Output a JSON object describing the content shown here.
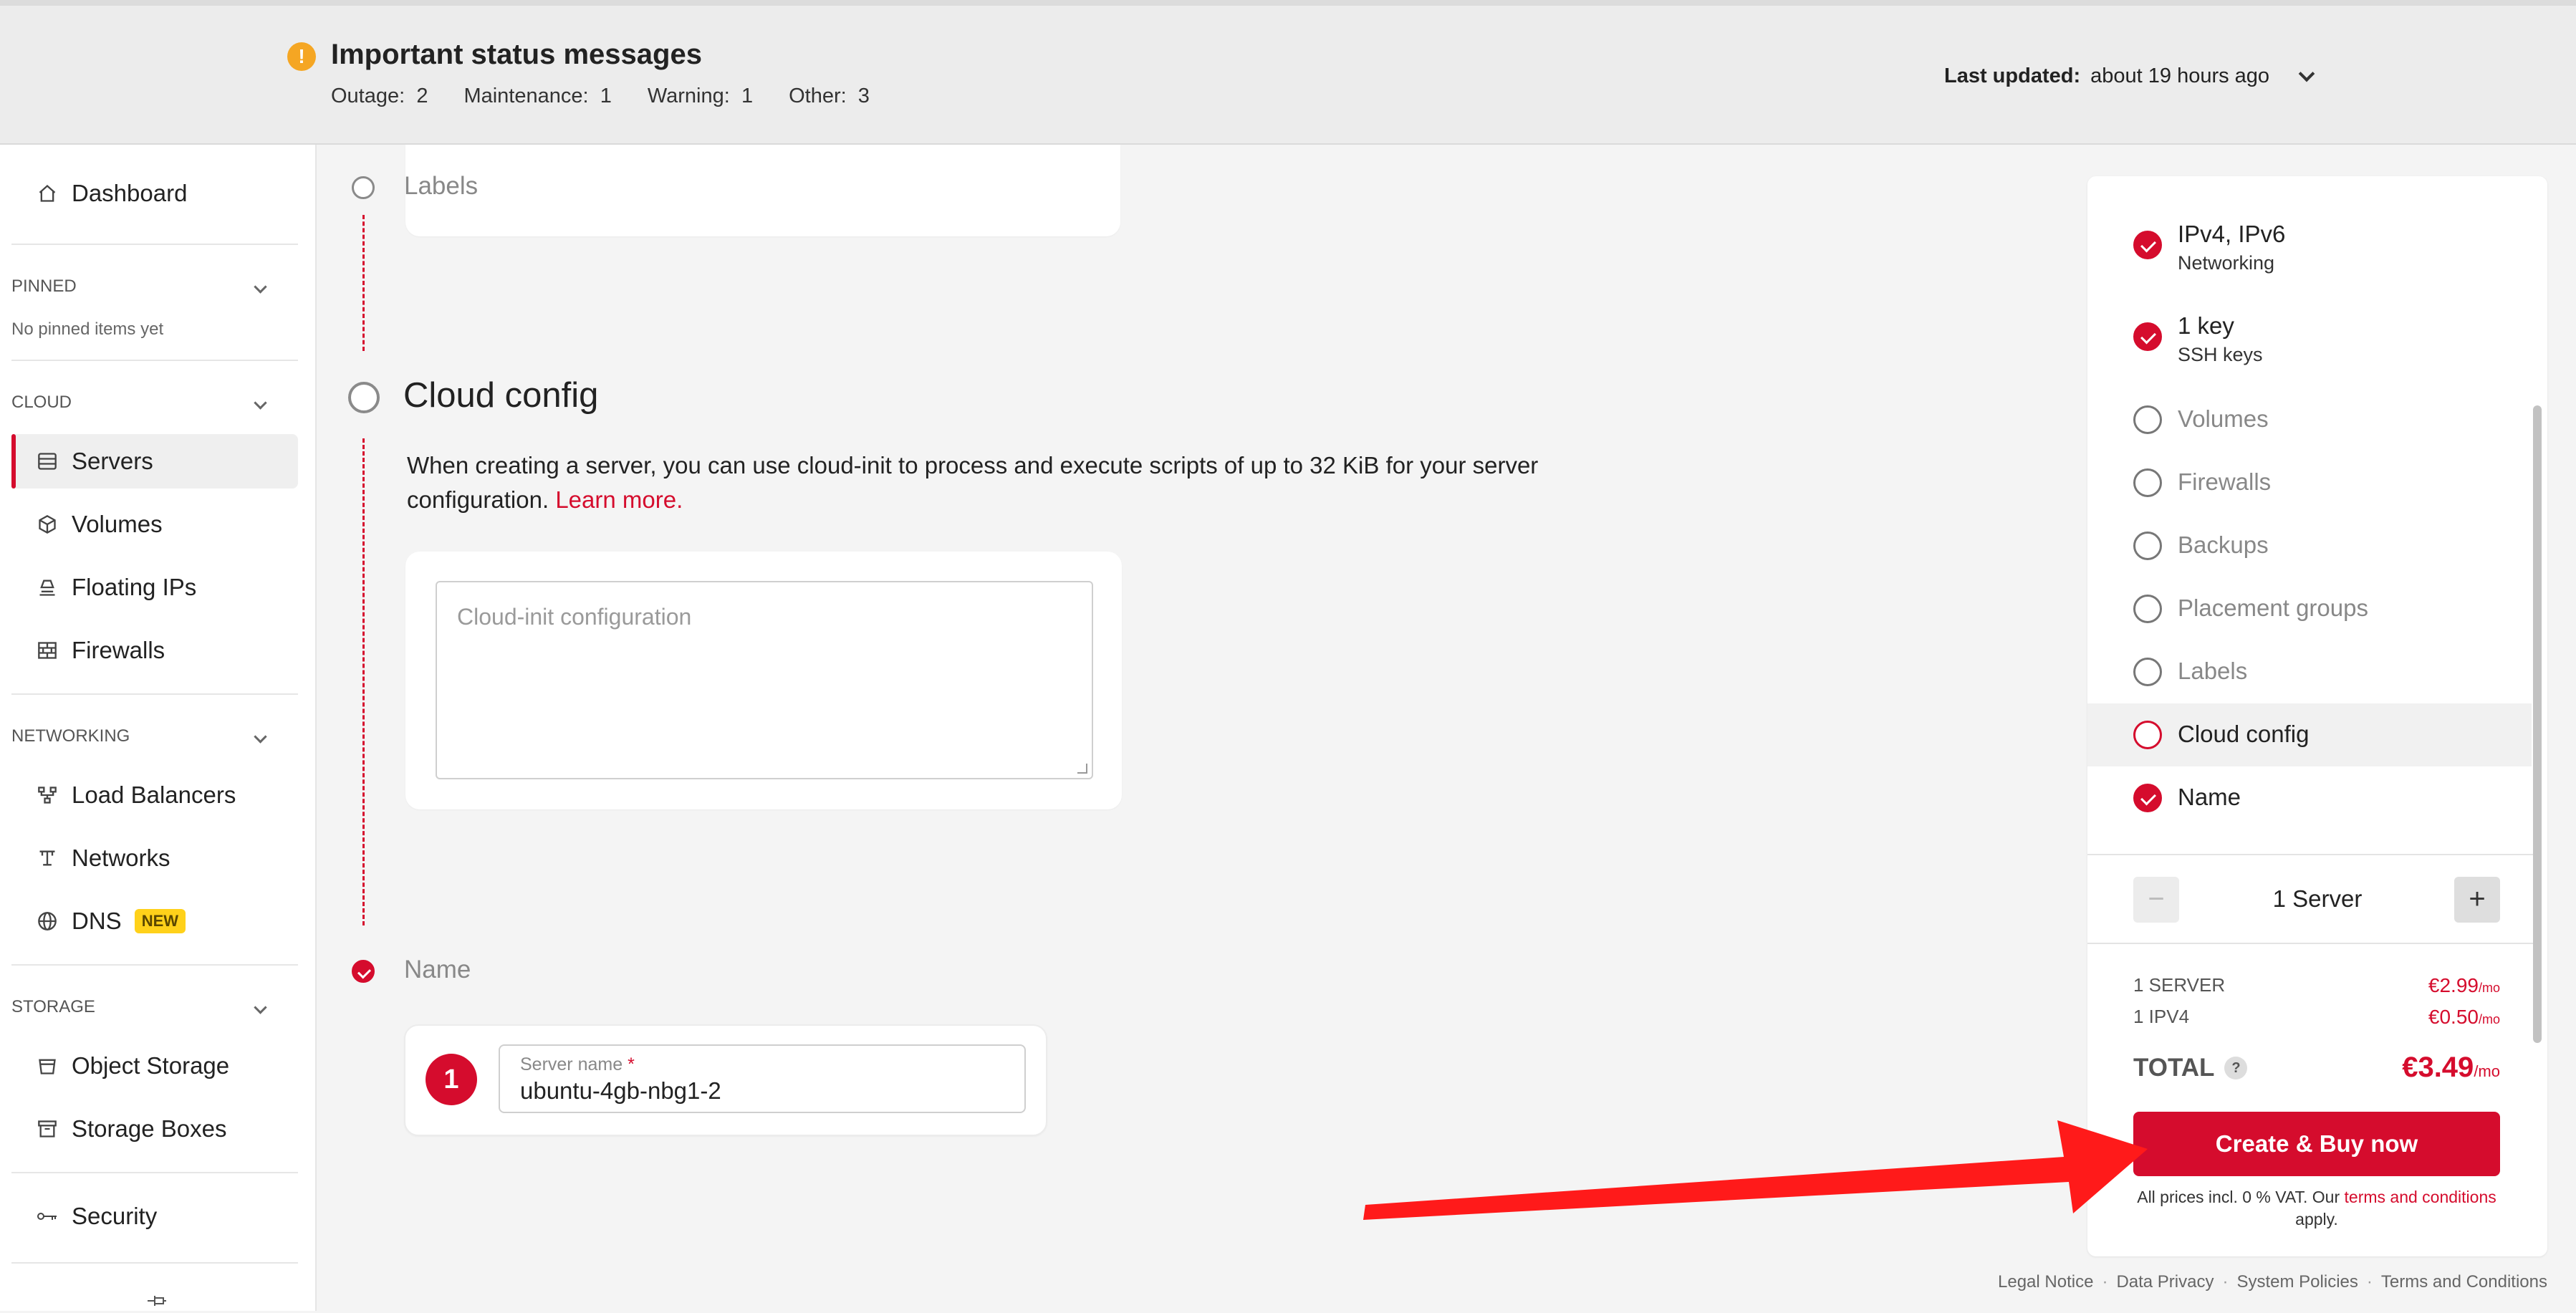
{
  "status": {
    "title": "Important status messages",
    "outage_label": "Outage:",
    "outage_count": "2",
    "maintenance_label": "Maintenance:",
    "maintenance_count": "1",
    "warning_label": "Warning:",
    "warning_count": "1",
    "other_label": "Other:",
    "other_count": "3",
    "last_updated_label": "Last updated:",
    "last_updated_value": "about 19 hours ago"
  },
  "sidebar": {
    "dashboard": "Dashboard",
    "pinned_heading": "PINNED",
    "pinned_empty": "No pinned items yet",
    "cloud_heading": "CLOUD",
    "servers": "Servers",
    "volumes": "Volumes",
    "floating_ips": "Floating IPs",
    "firewalls": "Firewalls",
    "networking_heading": "NETWORKING",
    "load_balancers": "Load Balancers",
    "networks": "Networks",
    "dns": "DNS",
    "dns_badge": "NEW",
    "storage_heading": "STORAGE",
    "object_storage": "Object Storage",
    "storage_boxes": "Storage Boxes",
    "security": "Security"
  },
  "main": {
    "labels_step": "Labels",
    "cloud_config_title": "Cloud config",
    "cloud_config_desc": "When creating a server, you can use cloud-init to process and execute scripts of up to 32 KiB for your server configuration.",
    "learn_more": "Learn more.",
    "cloud_init_placeholder": "Cloud-init configuration",
    "name_step": "Name",
    "server_number": "1",
    "server_name_label": "Server name",
    "server_name_required": "*",
    "server_name_value": "ubuntu-4gb-nbg1-2"
  },
  "summary": {
    "networking_value": "IPv4, IPv6",
    "networking_label": "Networking",
    "ssh_value": "1 key",
    "ssh_label": "SSH keys",
    "volumes": "Volumes",
    "firewalls": "Firewalls",
    "backups": "Backups",
    "placement_groups": "Placement groups",
    "labels": "Labels",
    "cloud_config": "Cloud config",
    "name": "Name",
    "minus": "−",
    "plus": "+",
    "server_count": "1 Server",
    "server_line_label": "1 SERVER",
    "server_line_price": "€2.99",
    "ipv4_line_label": "1 IPV4",
    "ipv4_line_price": "€0.50",
    "per_month": "/mo",
    "total_label": "TOTAL",
    "total_help": "?",
    "total_price": "€3.49",
    "buy_button": "Create & Buy now",
    "vat_prefix": "All prices incl. 0 % VAT. Our",
    "terms_link": "terms and conditions",
    "vat_suffix": "apply."
  },
  "footer": {
    "legal": "Legal Notice",
    "privacy": "Data Privacy",
    "policies": "System Policies",
    "terms": "Terms and Conditions",
    "separator": "·"
  },
  "colors": {
    "brand_red": "#d50c2d",
    "warning_orange": "#f5a623",
    "badge_yellow": "#ffd11a",
    "annotation_arrow": "#ff1a1a"
  },
  "icons": {
    "status": "exclamation-icon",
    "dashboard": "home-icon",
    "servers": "server-icon",
    "volumes": "cube-icon",
    "floating_ips": "floating-ip-icon",
    "firewalls": "brick-wall-icon",
    "load_balancers": "load-balancer-icon",
    "networks": "network-icon",
    "dns": "globe-icon",
    "object_storage": "bucket-icon",
    "storage_boxes": "archive-box-icon",
    "security": "key-icon",
    "pin": "pin-icon"
  }
}
